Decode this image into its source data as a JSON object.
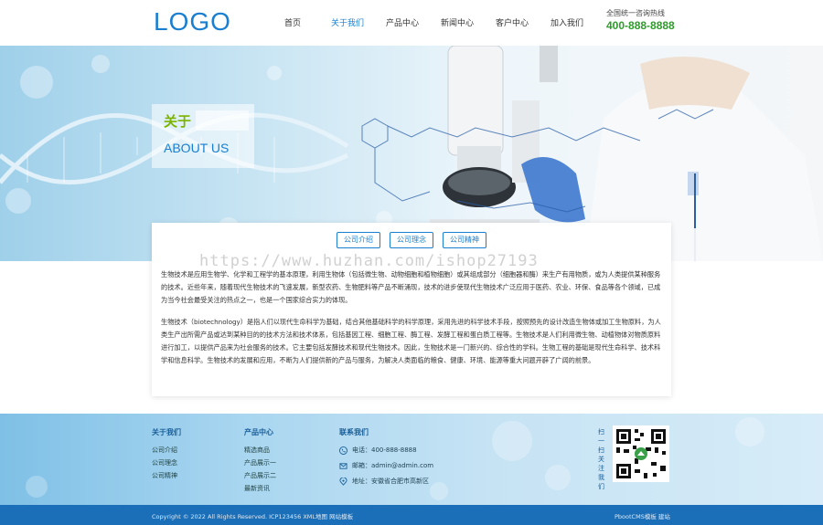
{
  "header": {
    "logo": "LOGO",
    "nav": [
      "首页",
      "关于我们",
      "产品中心",
      "新闻中心",
      "客户中心",
      "加入我们"
    ],
    "active_index": 1,
    "hotline_label": "全国统一咨询热线",
    "hotline_phone": "400-888-8888"
  },
  "banner": {
    "title_cn": "关于",
    "title_en": "ABOUT US"
  },
  "tabs": [
    "公司介绍",
    "公司理念",
    "公司精神"
  ],
  "watermark": "https://www.huzhan.com/ishop27193",
  "content": {
    "p1": "生物技术是应用生物学、化学和工程学的基本原理，利用生物体（包括微生物、动物细胞和植物细胞）或其组成部分（细胞器和酶）来生产有用物质，或为人类提供某种服务的技术。近些年来，随着现代生物技术的飞速发展，新型农药、生物肥料等产品不断涌现，技术的进步使现代生物技术广泛应用于医药、农业、环保、食品等各个领域，已成为当今社会最受关注的热点之一，也是一个国家综合实力的体现。",
    "p2": "生物技术（biotechnology）是指人们以现代生命科学为基础，结合其他基础科学的科学原理，采用先进的科学技术手段，按照预先的设计改造生物体或加工生物原料，为人类生产出所需产品或达到某种目的的技术方法和技术体系，包括基因工程、细胞工程、酶工程、发酵工程和蛋白质工程等。生物技术是人们利用微生物、动植物体对物质原料进行加工，以提供产品来为社会服务的技术。它主要包括发酵技术和现代生物技术。因此，生物技术是一门新兴的、综合性的学科。生物工程的基础是现代生命科学、技术科学和信息科学。生物技术的发展和应用，不断为人们提供新的产品与服务，为解决人类面临的粮食、健康、环境、能源等重大问题开辟了广阔的前景。"
  },
  "footer": {
    "about": {
      "title": "关于我们",
      "links": [
        "公司介绍",
        "公司理念",
        "公司精神"
      ]
    },
    "products": {
      "title": "产品中心",
      "links": [
        "精选商品",
        "产品展示一",
        "产品展示二",
        "最新资讯"
      ]
    },
    "contact": {
      "title": "联系我们",
      "phone": "电话：400-888-8888",
      "email": "邮箱：admin@admin.com",
      "address": "地址：安徽省合肥市高新区"
    },
    "qr_caption": "扫一扫关注我们",
    "copyright": "Copyright © 2022 All Rights Reserved. ICP123456 XML地图 网站模板",
    "bottom_right": "PbootCMS模板  建站"
  },
  "colors": {
    "brand_blue": "#1a7fd0",
    "green": "#2e9b2a",
    "footer_bar": "#1b6fb8"
  }
}
